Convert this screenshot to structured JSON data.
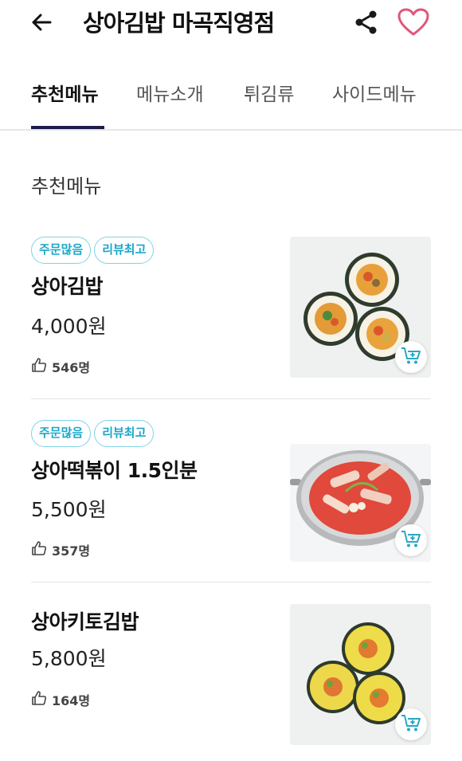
{
  "header": {
    "title": "상아김밥 마곡직영점"
  },
  "tabs": [
    {
      "label": "추천메뉴",
      "active": true
    },
    {
      "label": "메뉴소개",
      "active": false
    },
    {
      "label": "튀김류",
      "active": false
    },
    {
      "label": "사이드메뉴",
      "active": false
    }
  ],
  "section": {
    "title": "추천메뉴"
  },
  "menu_items": [
    {
      "badges": [
        "주문많음",
        "리뷰최고"
      ],
      "name": "상아김밥",
      "price": "4,000원",
      "likes": "546명",
      "image": "gimbap-icon"
    },
    {
      "badges": [
        "주문많음",
        "리뷰최고"
      ],
      "name": "상아떡볶이 1.5인분",
      "price": "5,500원",
      "likes": "357명",
      "image": "tteokbokki-icon"
    },
    {
      "badges": [],
      "name": "상아키토김밥",
      "price": "5,800원",
      "likes": "164명",
      "image": "keto-gimbap-icon"
    }
  ],
  "colors": {
    "accent_badge": "#1aa7c9",
    "badge_border": "#7fd3e6",
    "heart": "#e0567a",
    "tab_indicator": "#1d1d4a",
    "cart": "#2aa7c6"
  }
}
